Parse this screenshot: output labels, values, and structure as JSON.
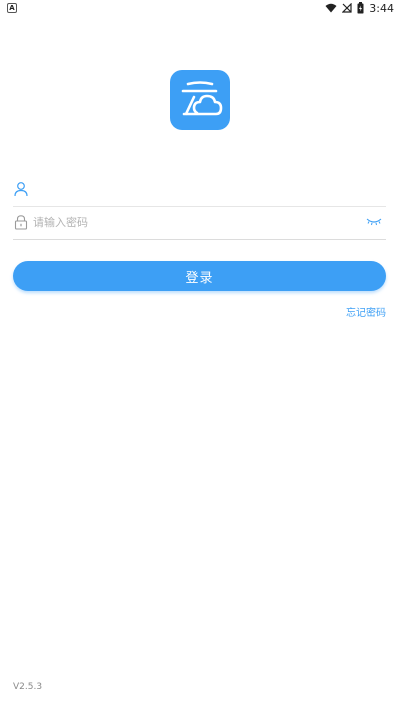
{
  "status_bar": {
    "left_icon_label": "A",
    "time": "3:44"
  },
  "login_form": {
    "username_placeholder": "",
    "password_placeholder": "请输入密码",
    "login_label": "登录",
    "forgot_password_label": "忘记密码"
  },
  "footer": {
    "version": "V2.5.3"
  },
  "colors": {
    "accent": "#3d9ff5",
    "background": "#ffffff"
  },
  "icons": {
    "logo": "cloud-logo-icon",
    "user": "user-icon",
    "lock": "lock-icon",
    "eye": "eye-closed-icon"
  }
}
